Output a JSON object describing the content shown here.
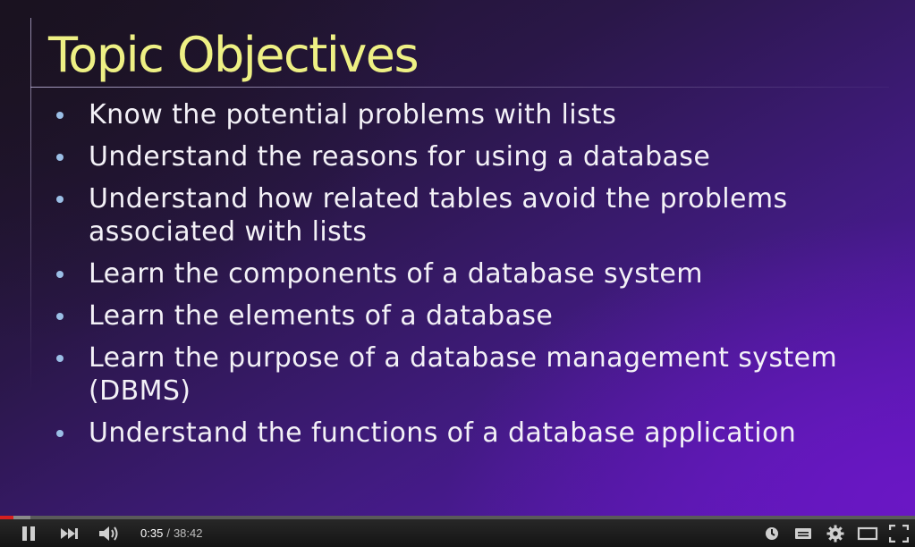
{
  "slide": {
    "title": "Topic Objectives",
    "bullets": [
      "Know the potential problems with lists",
      "Understand the reasons for using a database",
      "Understand how related tables avoid the problems associated with lists",
      "Learn the components of a database system",
      "Learn the elements of a database",
      "Learn the purpose of a database management system (DBMS)",
      "Understand the functions of a database application"
    ],
    "colors": {
      "title": "#eef084",
      "text": "#f3f1f7",
      "bullet": "#9bbfe6"
    }
  },
  "player": {
    "current_time": "0:35",
    "separator": "/",
    "duration": "38:42",
    "progress_played": 0.015,
    "progress_buffered": 0.033,
    "icons": {
      "play_pause": "pause-icon",
      "next": "next-icon",
      "volume": "volume-icon",
      "watch_later": "clock-icon",
      "captions": "captions-icon",
      "settings": "gear-icon",
      "theater": "theater-mode-icon",
      "fullscreen": "fullscreen-icon"
    },
    "colors": {
      "played": "#d62020",
      "bar_bg": "#1b1b1b"
    }
  }
}
